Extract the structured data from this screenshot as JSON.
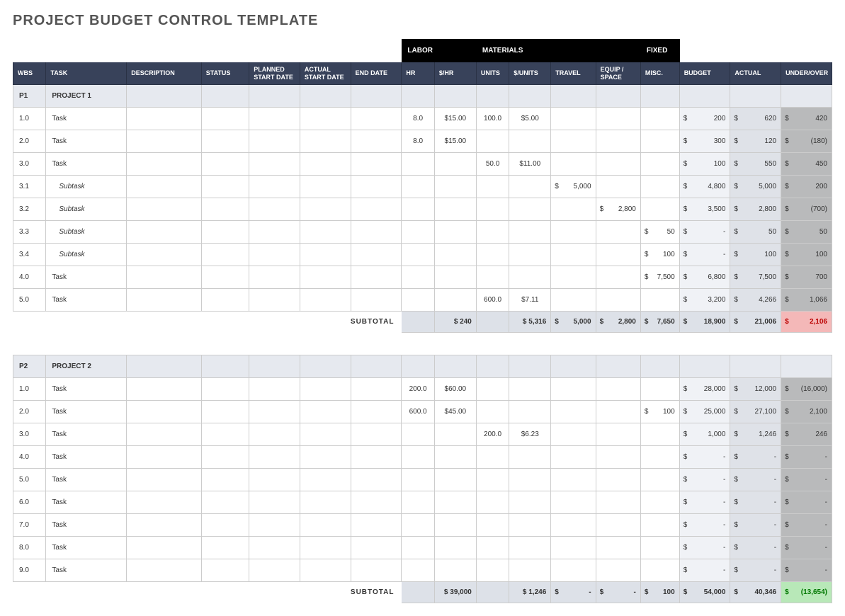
{
  "title": "PROJECT BUDGET CONTROL TEMPLATE",
  "groups": {
    "labor": "LABOR",
    "materials": "MATERIALS",
    "fixed": "FIXED"
  },
  "headers": {
    "wbs": "WBS",
    "task": "TASK",
    "desc": "DESCRIPTION",
    "status": "STATUS",
    "pstart": "PLANNED START DATE",
    "astart": "ACTUAL START DATE",
    "end": "END DATE",
    "hr": "HR",
    "dhr": "$/HR",
    "units": "UNITS",
    "dunits": "$/UNITS",
    "travel": "TRAVEL",
    "equip": "EQUIP / SPACE",
    "misc": "MISC.",
    "budget": "BUDGET",
    "actual": "ACTUAL",
    "over": "UNDER/OVER"
  },
  "subtotal_label": "SUBTOTAL",
  "projects": [
    {
      "id": "P1",
      "name": "PROJECT 1",
      "rows": [
        {
          "wbs": "1.0",
          "task": "Task",
          "hr": "8.0",
          "dhr": "$15.00",
          "units": "100.0",
          "dunits": "$5.00",
          "budget": "200",
          "actual": "620",
          "over": "420"
        },
        {
          "wbs": "2.0",
          "task": "Task",
          "hr": "8.0",
          "dhr": "$15.00",
          "budget": "300",
          "actual": "120",
          "over": "(180)"
        },
        {
          "wbs": "3.0",
          "task": "Task",
          "units": "50.0",
          "dunits": "$11.00",
          "budget": "100",
          "actual": "550",
          "over": "450"
        },
        {
          "wbs": "3.1",
          "task": "Subtask",
          "sub": true,
          "travel": "5,000",
          "budget": "4,800",
          "actual": "5,000",
          "over": "200"
        },
        {
          "wbs": "3.2",
          "task": "Subtask",
          "sub": true,
          "equip": "2,800",
          "budget": "3,500",
          "actual": "2,800",
          "over": "(700)"
        },
        {
          "wbs": "3.3",
          "task": "Subtask",
          "sub": true,
          "misc": "50",
          "budget": "-",
          "actual": "50",
          "over": "50"
        },
        {
          "wbs": "3.4",
          "task": "Subtask",
          "sub": true,
          "misc": "100",
          "budget": "-",
          "actual": "100",
          "over": "100"
        },
        {
          "wbs": "4.0",
          "task": "Task",
          "misc": "7,500",
          "budget": "6,800",
          "actual": "7,500",
          "over": "700"
        },
        {
          "wbs": "5.0",
          "task": "Task",
          "units": "600.0",
          "dunits": "$7.11",
          "budget": "3,200",
          "actual": "4,266",
          "over": "1,066"
        }
      ],
      "subtotal": {
        "dhr": "$   240",
        "dunits": "$  5,316",
        "travel": "5,000",
        "equip": "2,800",
        "misc": "7,650",
        "budget": "18,900",
        "actual": "21,006",
        "over": "2,106",
        "over_class": "over-red"
      }
    },
    {
      "id": "P2",
      "name": "PROJECT 2",
      "rows": [
        {
          "wbs": "1.0",
          "task": "Task",
          "hr": "200.0",
          "dhr": "$60.00",
          "budget": "28,000",
          "actual": "12,000",
          "over": "(16,000)"
        },
        {
          "wbs": "2.0",
          "task": "Task",
          "hr": "600.0",
          "dhr": "$45.00",
          "misc": "100",
          "budget": "25,000",
          "actual": "27,100",
          "over": "2,100"
        },
        {
          "wbs": "3.0",
          "task": "Task",
          "units": "200.0",
          "dunits": "$6.23",
          "budget": "1,000",
          "actual": "1,246",
          "over": "246"
        },
        {
          "wbs": "4.0",
          "task": "Task",
          "budget": "-",
          "actual": "-",
          "over": "-"
        },
        {
          "wbs": "5.0",
          "task": "Task",
          "budget": "-",
          "actual": "-",
          "over": "-"
        },
        {
          "wbs": "6.0",
          "task": "Task",
          "budget": "-",
          "actual": "-",
          "over": "-"
        },
        {
          "wbs": "7.0",
          "task": "Task",
          "budget": "-",
          "actual": "-",
          "over": "-"
        },
        {
          "wbs": "8.0",
          "task": "Task",
          "budget": "-",
          "actual": "-",
          "over": "-"
        },
        {
          "wbs": "9.0",
          "task": "Task",
          "budget": "-",
          "actual": "-",
          "over": "-"
        }
      ],
      "subtotal": {
        "dhr": "$ 39,000",
        "dunits": "$  1,246",
        "travel": "-",
        "equip": "-",
        "misc": "100",
        "budget": "54,000",
        "actual": "40,346",
        "over": "(13,654)",
        "over_class": "over-green"
      }
    }
  ]
}
